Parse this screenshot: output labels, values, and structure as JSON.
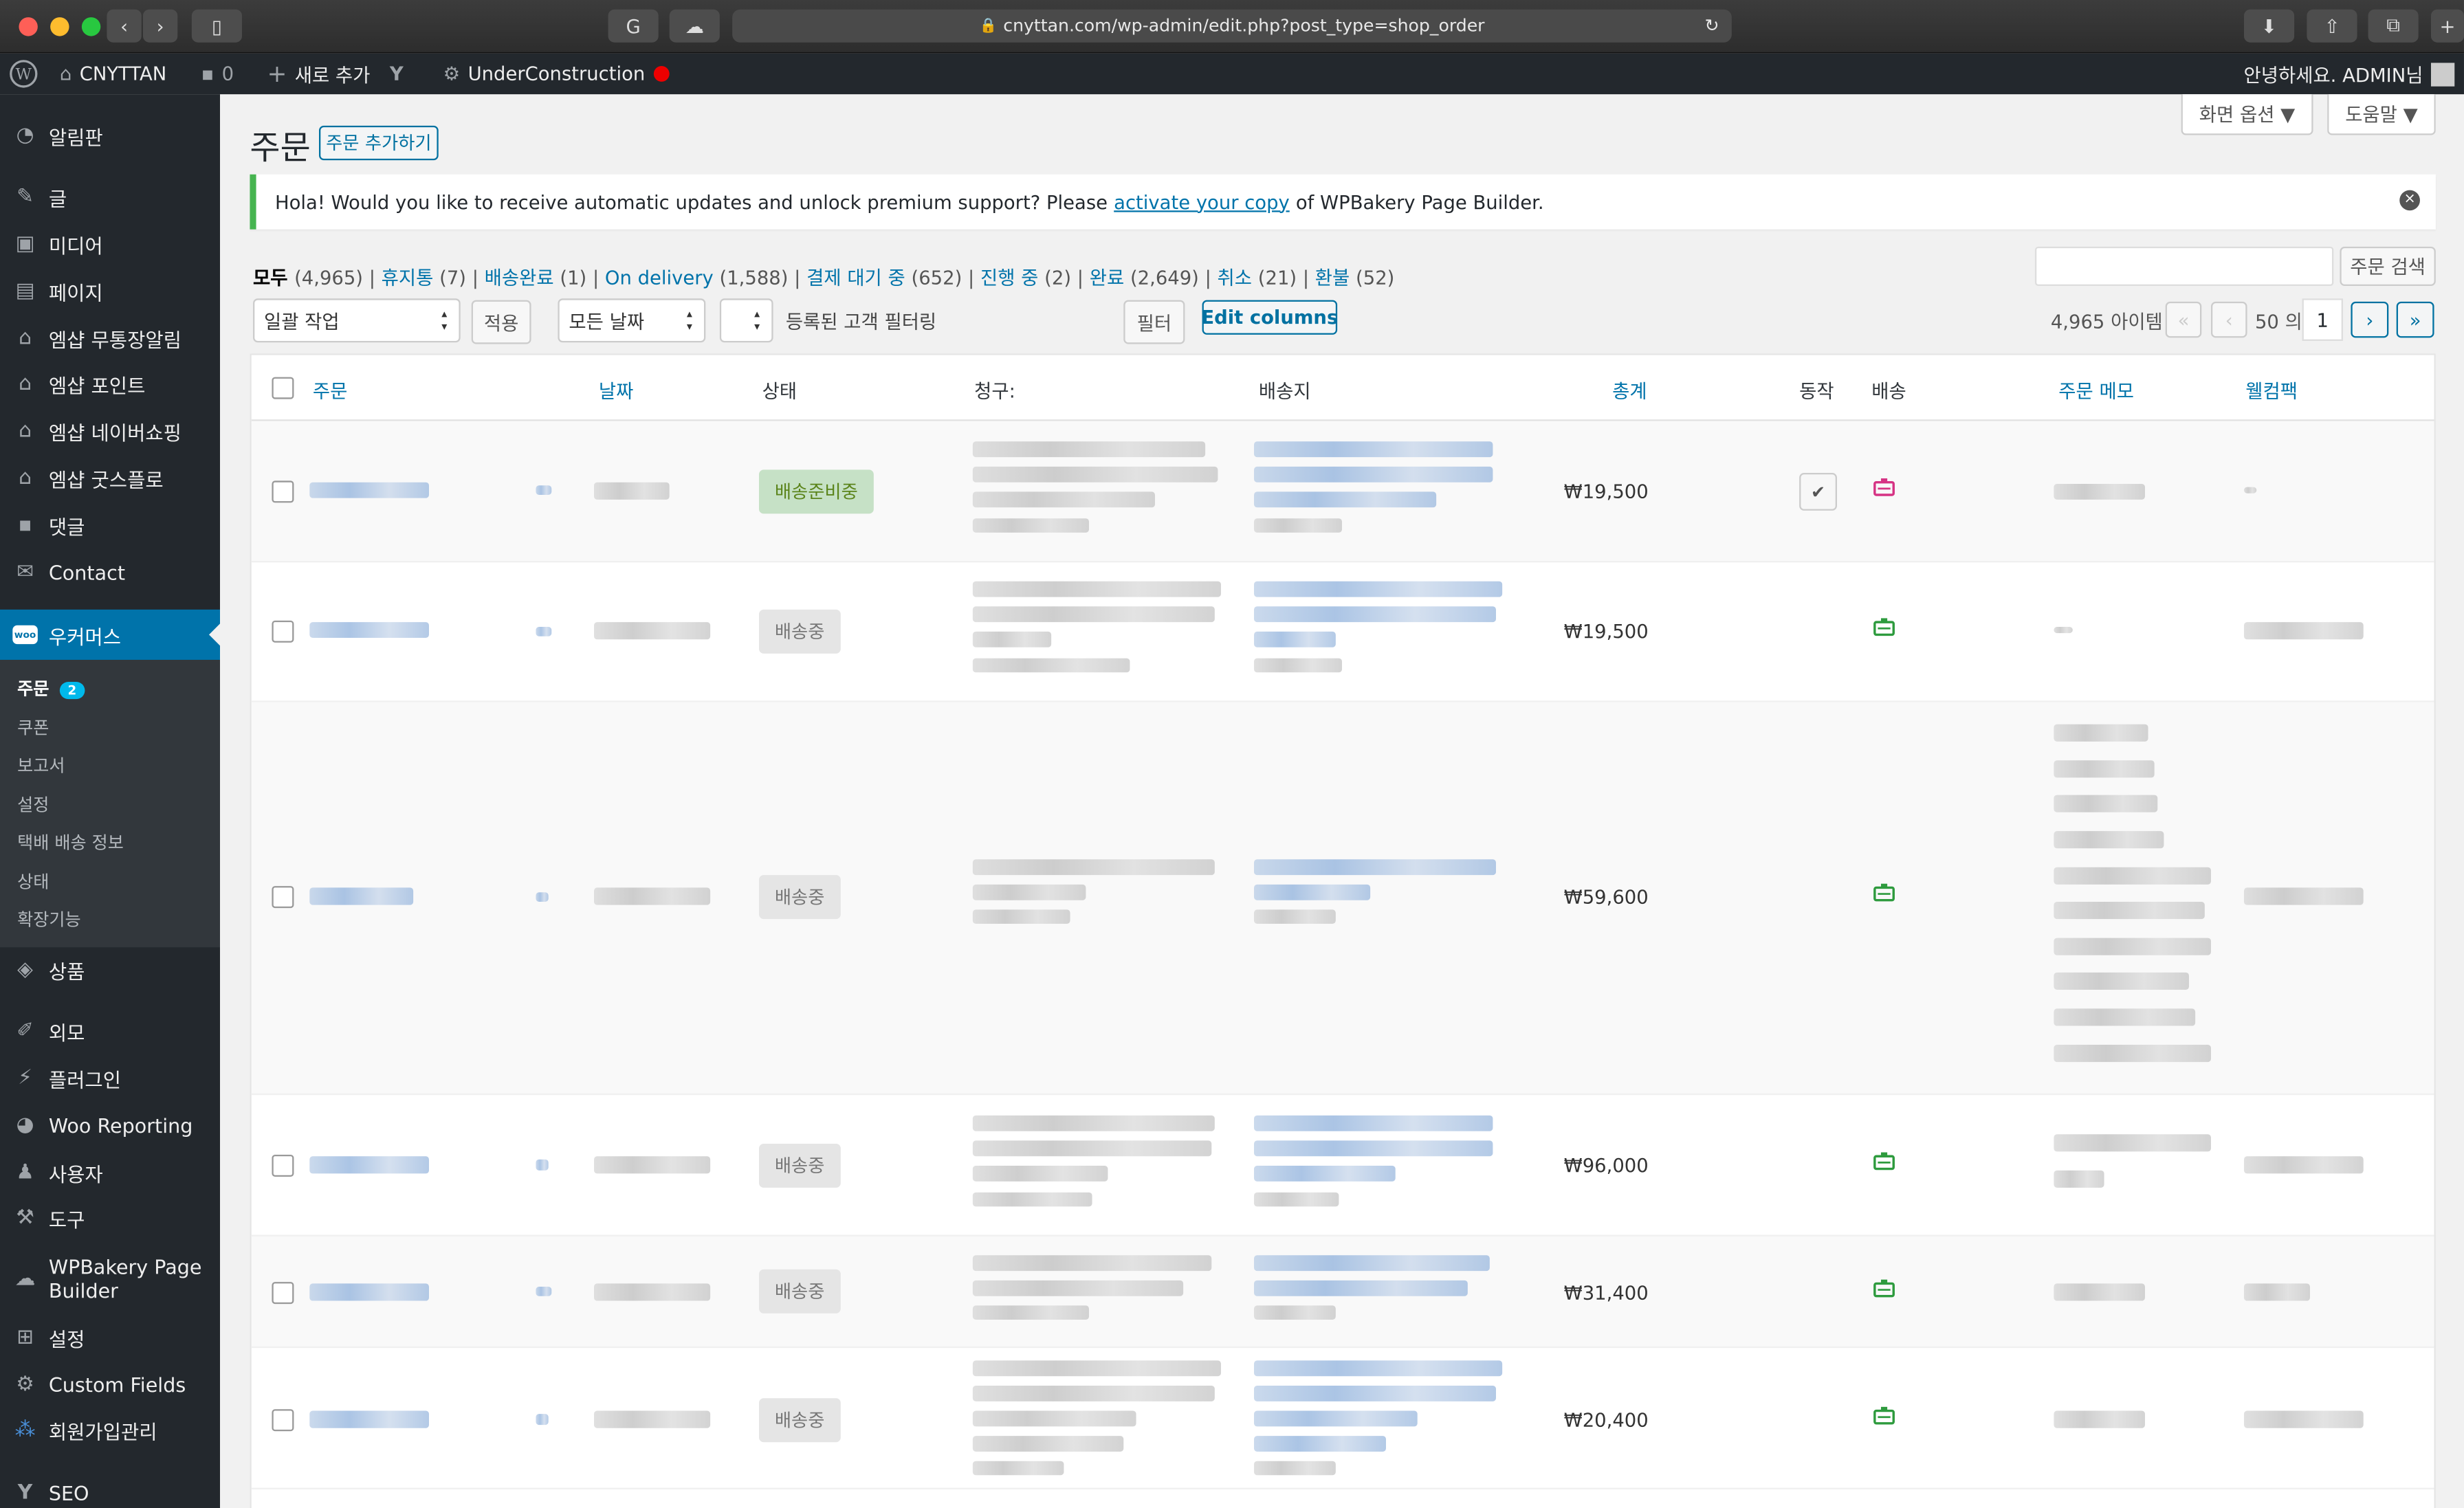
{
  "browser": {
    "url": "cnyttan.com/wp-admin/edit.php?post_type=shop_order"
  },
  "adminbar": {
    "site": "CNYTTAN",
    "comments": "0",
    "new": "새로 추가",
    "plugin": "UnderConstruction",
    "greeting": "안녕하세요. ADMIN님"
  },
  "sidebar": {
    "items": [
      {
        "label": "알림판",
        "icon": "dashboard-icon"
      },
      {
        "label": "글",
        "icon": "pin-icon"
      },
      {
        "label": "미디어",
        "icon": "media-icon"
      },
      {
        "label": "페이지",
        "icon": "page-icon"
      },
      {
        "label": "엠샵 무통장알림",
        "icon": "store-icon"
      },
      {
        "label": "엠샵 포인트",
        "icon": "store-icon"
      },
      {
        "label": "엠샵 네이버쇼핑",
        "icon": "store-icon"
      },
      {
        "label": "엠샵 굿스플로",
        "icon": "store-icon"
      },
      {
        "label": "댓글",
        "icon": "comment-icon"
      },
      {
        "label": "Contact",
        "icon": "mail-icon"
      },
      {
        "label": "우커머스",
        "icon": "woo-icon"
      }
    ],
    "woo_sub": {
      "orders": "주문",
      "orders_badge": "2",
      "coupons": "쿠폰",
      "reports": "보고서",
      "settings": "설정",
      "delivery": "택배 배송 정보",
      "status": "상태",
      "extensions": "확장기능"
    },
    "items2": [
      {
        "label": "상품",
        "icon": "box-icon"
      },
      {
        "label": "외모",
        "icon": "brush-icon"
      },
      {
        "label": "플러그인",
        "icon": "plug-icon"
      },
      {
        "label": "Woo Reporting",
        "icon": "chart-icon"
      },
      {
        "label": "사용자",
        "icon": "user-icon"
      },
      {
        "label": "도구",
        "icon": "wrench-icon"
      },
      {
        "label": "WPBakery Page Builder",
        "icon": "cloud-icon"
      },
      {
        "label": "설정",
        "icon": "settings-icon"
      },
      {
        "label": "Custom Fields",
        "icon": "gear-icon"
      },
      {
        "label": "회원가입관리",
        "icon": "members-icon"
      },
      {
        "label": "SEO",
        "icon": "yoast-icon"
      }
    ]
  },
  "header": {
    "title": "주문",
    "add_button": "주문 추가하기",
    "screen_options": "화면 옵션 ▼",
    "help": "도움말 ▼"
  },
  "notice": {
    "before": "Hola! Would you like to receive automatic updates and unlock premium support? Please",
    "link": "activate your copy",
    "after": "of WPBakery Page Builder."
  },
  "filters": {
    "all": "모두",
    "all_count": "(4,965)",
    "trash": "휴지통",
    "trash_count": "(7)",
    "shipped": "배송완료",
    "shipped_count": "(1)",
    "ondelivery": "On delivery",
    "ondelivery_count": "(1,588)",
    "pending": "결제 대기 중",
    "pending_count": "(652)",
    "processing": "진행 중",
    "processing_count": "(2)",
    "completed": "완료",
    "completed_count": "(2,649)",
    "cancelled": "취소",
    "cancelled_count": "(21)",
    "refunded": "환불",
    "refunded_count": "(52)"
  },
  "toolbar": {
    "bulk": "일괄 작업",
    "apply": "적용",
    "dates": "모든 날짜",
    "customer_filter": "등록된 고객 필터링",
    "filter": "필터",
    "edit_columns": "Edit columns",
    "search_button": "주문 검색",
    "items_count": "4,965 아이템",
    "page_of": "50 의",
    "page": "1",
    "first": "«",
    "prev": "‹",
    "next": "›",
    "last": "»"
  },
  "columns": {
    "order": "주문",
    "date": "날짜",
    "status": "상태",
    "billing": "청구:",
    "shipping": "배송지",
    "total": "총계",
    "actions": "동작",
    "delivery": "배송",
    "note": "주문 메모",
    "welcome": "웰컴팩"
  },
  "orders": [
    {
      "status": "배송준비중",
      "total": "₩19,500"
    },
    {
      "status": "배송중",
      "total": "₩19,500"
    },
    {
      "status": "배송중",
      "total": "₩59,600"
    },
    {
      "status": "배송중",
      "total": "₩96,000"
    },
    {
      "status": "배송중",
      "total": "₩31,400"
    },
    {
      "status": "배송중",
      "total": "₩20,400"
    }
  ],
  "colors": {
    "accent": "#0073aa",
    "sidebar": "#23282d",
    "active": "#0073aa",
    "ready_bg": "#c6e1c6",
    "ready_fg": "#5b841b"
  }
}
